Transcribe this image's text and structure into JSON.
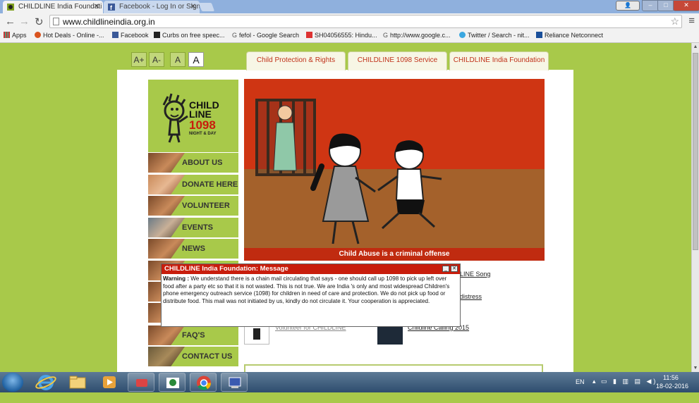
{
  "browser": {
    "tabs": [
      {
        "label": "CHILDLINE India Foundati",
        "active": true
      },
      {
        "label": "Facebook - Log In or Sign",
        "active": false
      }
    ],
    "address": "www.childlineindia.org.in",
    "bookmarks": [
      "Apps",
      "Hot Deals - Online -...",
      "Facebook",
      "Curbs on free speec...",
      "fefol - Google Search",
      "SH04056555: Hindu...",
      "http://www.google.c...",
      "Twitter / Search - nit...",
      "Reliance Netconnect"
    ]
  },
  "site": {
    "font_controls": [
      "A+",
      "A-",
      "A",
      "A"
    ],
    "top_tabs": [
      "Child Protection & Rights",
      "CHILDLINE 1098 Service",
      "CHILDLINE India Foundation"
    ],
    "logo": {
      "line1": "CHILD",
      "line2": "LINE",
      "number": "1098",
      "tag": "NIGHT & DAY"
    },
    "nav": [
      "ABOUT US",
      "DONATE HERE",
      "VOLUNTEER",
      "EVENTS",
      "NEWS",
      "FAQ'S",
      "CONTACT US"
    ],
    "hero_caption": "Child Abuse is a criminal offense",
    "links": {
      "song": "LINE Song",
      "distress": "distress",
      "left_bottom": "Volunteer for CHILDLINE",
      "right_bottom": "Childline Calling 2015"
    },
    "colors": {
      "accent": "#c81d0c",
      "green": "#a8c94a",
      "tab_text": "#c0321a"
    }
  },
  "modal": {
    "title": "CHILDLINE India Foundation: Message",
    "warning_label": "Warning :",
    "message": " We understand there is a chain mail circulating that says - one should call up 1098 to pick up left over food after a party etc so that it is not wasted. This is not true. We are India 's only and most widespread Children's phone emergency outreach service (1098) for children in need of care and protection. We do not pick up food or distribute food. This mail was not initiated by us, kindly do not circulate it. Your cooperation is appreciated."
  },
  "taskbar": {
    "lang": "EN",
    "time": "11:56",
    "date": "18-02-2016"
  }
}
